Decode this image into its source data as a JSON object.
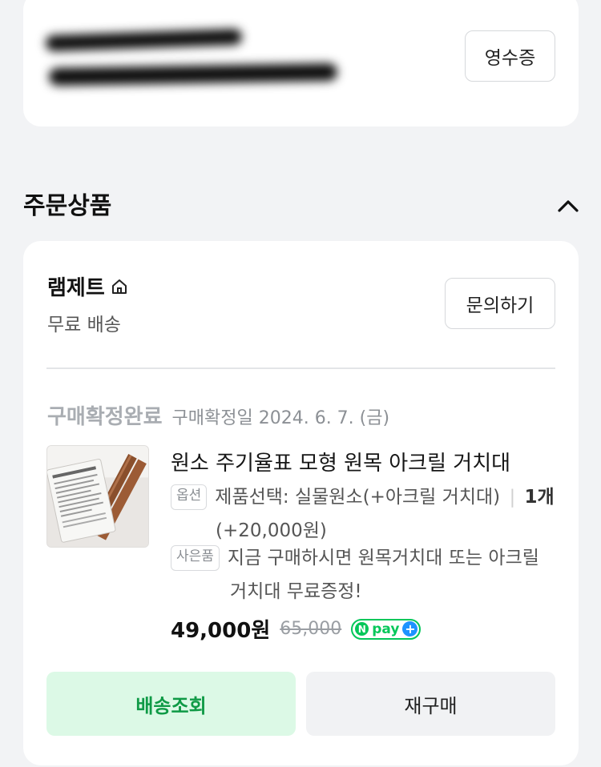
{
  "order_info": {
    "receipt_label": "영수증"
  },
  "section": {
    "title": "주문상품"
  },
  "seller": {
    "name": "램제트",
    "shipping": "무료 배송",
    "inquiry_label": "문의하기"
  },
  "order_item": {
    "status": "구매확정완료",
    "confirm_date": "구매확정일 2024. 6. 7. (금)",
    "product_name": "원소 주기율표 모형 원목 아크릴 거치대",
    "option_tag": "옵션",
    "option_text": "제품선택: 실물원소(+아크릴 거치대)",
    "quantity": "1개",
    "option_price": "(+20,000원)",
    "gift_tag": "사은품",
    "gift_text_1": "지금 구매하시면 원목거치대 또는 아크릴",
    "gift_text_2": "거치대 무료증정!",
    "price": "49,000원",
    "original_price": "65,000",
    "npay_letter": "N",
    "npay_text": "pay",
    "npay_plus": "+"
  },
  "actions": {
    "track_label": "배송조회",
    "rebuy_label": "재구매"
  },
  "colors": {
    "accent_green": "#03c75a",
    "track_bg": "#dcf9e6",
    "track_text": "#0f9a46",
    "page_bg": "#f2f3f5"
  },
  "icons": {
    "home": "home-icon",
    "chevron": "chevron-up-icon",
    "npay": "npay-plus-icon"
  }
}
